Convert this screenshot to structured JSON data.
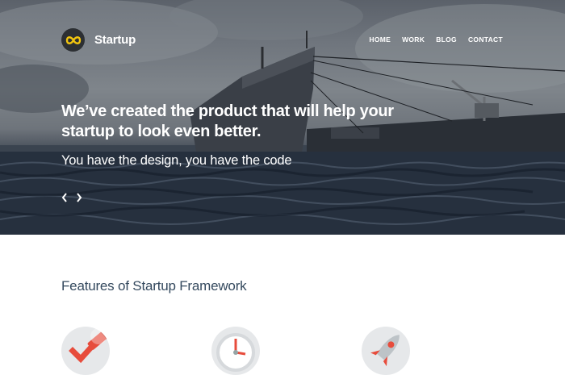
{
  "header": {
    "brand": "Startup",
    "nav": [
      "HOME",
      "WORK",
      "BLOG",
      "CONTACT"
    ]
  },
  "hero": {
    "headline": "We’ve created the product that will help your startup to look even better.",
    "subline": "You have the design, you have the code"
  },
  "features": {
    "title": "Features of Startup Framework",
    "icons": [
      "checkmark-pencil-icon",
      "clock-icon",
      "rocket-icon"
    ]
  },
  "colors": {
    "logo_accent": "#f1c40f",
    "feature_red": "#e74c3c",
    "heading": "#34495e"
  }
}
